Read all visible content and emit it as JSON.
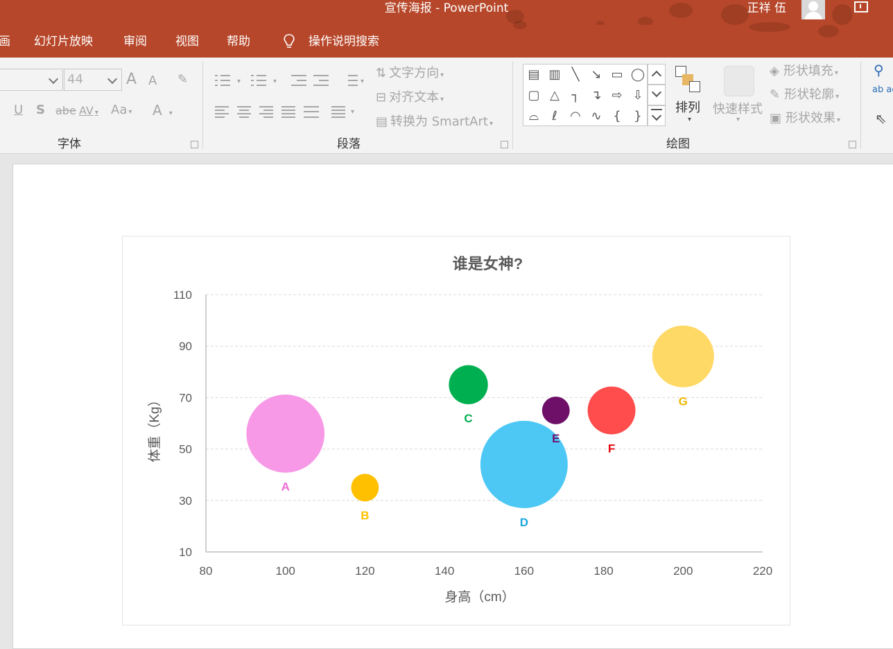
{
  "window": {
    "title": "宣传海报  -  PowerPoint",
    "user_name": "正祥 伍"
  },
  "menu": {
    "tabs": [
      "画",
      "幻灯片放映",
      "审阅",
      "视图",
      "帮助"
    ],
    "search_label": "操作说明搜索"
  },
  "ribbon": {
    "font_group": {
      "label": "字体",
      "font_size": "44",
      "grow_glyph": "A",
      "shrink_glyph": "A",
      "underline": "U",
      "shadow": "S",
      "strike": "abe",
      "spacing": "AV",
      "case": "Aa",
      "color": "A"
    },
    "paragraph_group": {
      "label": "段落",
      "text_direction": "文字方向",
      "align_text": "对齐文本",
      "smartart": "转换为 SmartArt"
    },
    "drawing_group": {
      "label": "绘图",
      "arrange": "排列",
      "quick_styles": "快速样式",
      "shape_fill": "形状填充",
      "shape_outline": "形状轮廓",
      "shape_effects": "形状效果"
    },
    "editing_group": {
      "replace_icon_text": "ab ac"
    }
  },
  "chart_data": {
    "type": "bubble",
    "title": "谁是女神?",
    "xlabel": "身高（cm）",
    "ylabel": "体重（Kg）",
    "xlim": [
      80,
      220
    ],
    "ylim": [
      10,
      110
    ],
    "x_ticks": [
      "80",
      "100",
      "120",
      "140",
      "160",
      "180",
      "200",
      "220"
    ],
    "y_ticks": [
      "10",
      "30",
      "50",
      "70",
      "90",
      "110"
    ],
    "grid": "horizontal dashed",
    "series": [
      {
        "name": "A",
        "x": 100,
        "y": 56,
        "size": 3.6,
        "color": "#f799e6"
      },
      {
        "name": "B",
        "x": 120,
        "y": 35,
        "size": 0.45,
        "color": "#ffc000"
      },
      {
        "name": "C",
        "x": 146,
        "y": 75,
        "size": 0.9,
        "color": "#00b050"
      },
      {
        "name": "D",
        "x": 160,
        "y": 44,
        "size": 4.5,
        "color": "#4dc8f5"
      },
      {
        "name": "E",
        "x": 168,
        "y": 65,
        "size": 0.45,
        "color": "#6f1068"
      },
      {
        "name": "F",
        "x": 182,
        "y": 65,
        "size": 1.35,
        "color": "#ff4d4d"
      },
      {
        "name": "G",
        "x": 200,
        "y": 86,
        "size": 2.25,
        "color": "#ffd966"
      }
    ],
    "label_colors": {
      "A": "#f06ad6",
      "B": "#ffc000",
      "C": "#00b050",
      "D": "#1aa8e0",
      "E": "#6f1068",
      "F": "#e8000b",
      "G": "#f0b800"
    }
  }
}
